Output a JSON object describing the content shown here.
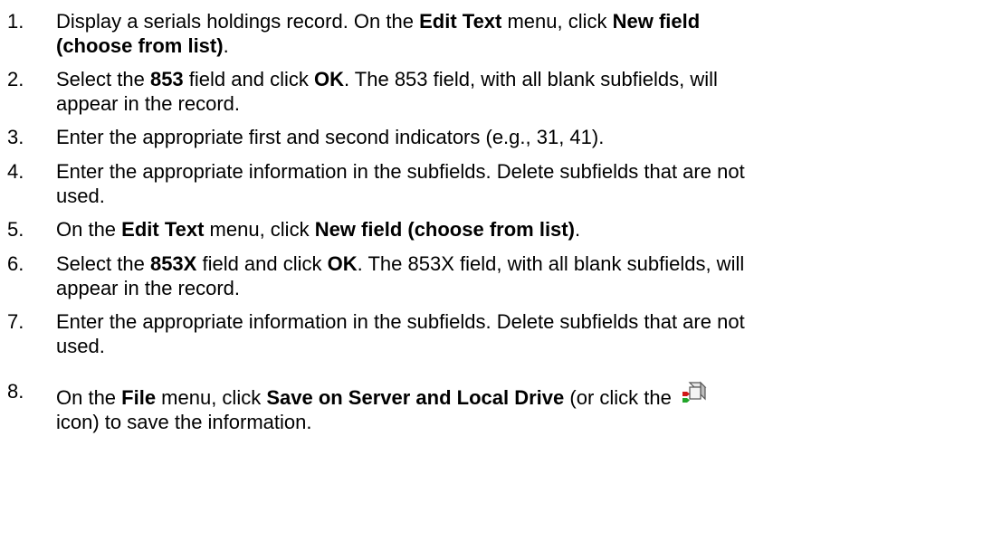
{
  "steps": [
    {
      "number": "1.",
      "segments": [
        {
          "text": "Display a serials holdings record. On the ",
          "bold": false
        },
        {
          "text": "Edit Text",
          "bold": true
        },
        {
          "text": " menu, click ",
          "bold": false
        },
        {
          "text": "New field",
          "bold": true
        },
        {
          "text": "(choose from list)",
          "bold": true,
          "break_before": true
        },
        {
          "text": ".",
          "bold": false
        }
      ]
    },
    {
      "number": "2.",
      "segments": [
        {
          "text": "Select the ",
          "bold": false
        },
        {
          "text": "853",
          "bold": true
        },
        {
          "text": " field and click ",
          "bold": false
        },
        {
          "text": "OK",
          "bold": true
        },
        {
          "text": ". The 853 field, with all blank subfields, will",
          "bold": false
        },
        {
          "text": "appear in the record.",
          "bold": false,
          "break_before": true
        }
      ]
    },
    {
      "number": "3.",
      "segments": [
        {
          "text": "Enter the appropriate first and second indicators (e.g., 31, 41).",
          "bold": false
        }
      ]
    },
    {
      "number": "4.",
      "segments": [
        {
          "text": "Enter the appropriate information in the subfields. Delete subfields that are not",
          "bold": false
        },
        {
          "text": "used.",
          "bold": false,
          "break_before": true
        }
      ]
    },
    {
      "number": "5.",
      "segments": [
        {
          "text": "On the ",
          "bold": false
        },
        {
          "text": "Edit Text",
          "bold": true
        },
        {
          "text": " menu, click ",
          "bold": false
        },
        {
          "text": "New field (choose from list)",
          "bold": true
        },
        {
          "text": ".",
          "bold": false
        }
      ]
    },
    {
      "number": "6.",
      "segments": [
        {
          "text": "Select the ",
          "bold": false
        },
        {
          "text": "853X",
          "bold": true
        },
        {
          "text": " field and click ",
          "bold": false
        },
        {
          "text": "OK",
          "bold": true
        },
        {
          "text": ". The 853X field, with all blank subfields, will",
          "bold": false
        },
        {
          "text": "appear in the record.",
          "bold": false,
          "break_before": true
        }
      ]
    },
    {
      "number": "7.",
      "segments": [
        {
          "text": "Enter the appropriate information in the subfields. Delete subfields that are not",
          "bold": false
        },
        {
          "text": "used.",
          "bold": false,
          "break_before": true
        }
      ]
    },
    {
      "number": "8.",
      "segments": [
        {
          "text": "On the ",
          "bold": false
        },
        {
          "text": "File",
          "bold": true
        },
        {
          "text": " menu, click ",
          "bold": false
        },
        {
          "text": "Save on Server and Local Drive",
          "bold": true
        },
        {
          "text": " (or click the ",
          "bold": false
        },
        {
          "icon": "save-on-server-and-local-drive-icon"
        },
        {
          "text": "icon) to save the information.",
          "bold": false,
          "break_before": true
        }
      ]
    }
  ]
}
